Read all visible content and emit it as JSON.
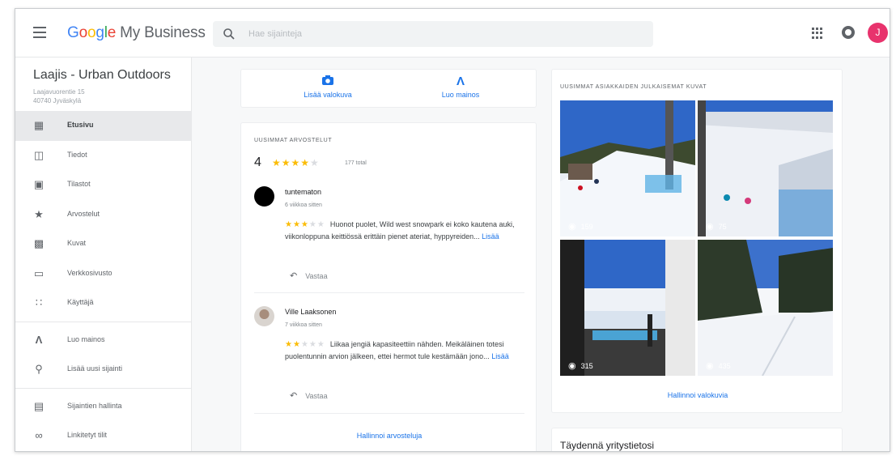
{
  "header": {
    "brand_word": [
      "G",
      "o",
      "o",
      "g",
      "l",
      "e"
    ],
    "product": "My Business",
    "search_placeholder": "Hae sijainteja",
    "avatar_initial": "J",
    "icons": [
      "menu-icon",
      "search-icon",
      "apps-icon",
      "notifications-icon"
    ]
  },
  "sidebar": {
    "business_name": "Laajis - Urban Outdoors",
    "address_line1": "Laajavuorentie 15",
    "address_line2": "40740 Jyväskylä",
    "items": [
      {
        "label": "Etusivu",
        "icon": "home-icon",
        "active": true
      },
      {
        "label": "Tiedot",
        "icon": "store-icon"
      },
      {
        "label": "Tilastot",
        "icon": "insights-icon"
      },
      {
        "label": "Arvostelut",
        "icon": "star-icon"
      },
      {
        "label": "Kuvat",
        "icon": "photos-icon"
      },
      {
        "label": "Verkkosivusto",
        "icon": "website-icon"
      },
      {
        "label": "Käyttäjä",
        "icon": "users-icon"
      },
      {
        "label": "Luo mainos",
        "icon": "ads-icon"
      },
      {
        "label": "Lisää uusi sijainti",
        "icon": "location-pin-icon"
      },
      {
        "label": "Sijaintien hallinta",
        "icon": "locations-icon"
      },
      {
        "label": "Linkitetyt tilit",
        "icon": "link-icon"
      }
    ]
  },
  "actions": {
    "add_photo": "Lisää valokuva",
    "create_ad": "Luo mainos"
  },
  "reviews": {
    "title": "UUSIMMAT ARVOSTELUT",
    "rating": "4",
    "rating_stars": 4,
    "total": "177 total",
    "items": [
      {
        "name": "tuntematon",
        "time": "6 viikkoa sitten",
        "stars": 3,
        "text": "Huonot puolet, Wild west snowpark ei koko kautena auki, viikonloppuna keittiössä erittäin pienet ateriat, hyppyreiden...",
        "more": "Lisää",
        "reply": "Vastaa"
      },
      {
        "name": "Ville Laaksonen",
        "time": "7 viikkoa sitten",
        "stars": 2,
        "text": "Liikaa jengiä kapasiteettiin nähden. Meikäläinen totesi puolentunnin arvion jälkeen, ettei hermot tule kestämään jono...",
        "more": "Lisää",
        "reply": "Vastaa"
      }
    ],
    "manage": "Hallinnoi arvosteluja"
  },
  "photos": {
    "title": "UUSIMMAT ASIAKKAIDEN JULKAISEMAT KUVAT",
    "items": [
      {
        "views": "159"
      },
      {
        "views": "75"
      },
      {
        "views": "315"
      },
      {
        "views": "435"
      }
    ],
    "manage": "Hallinnoi valokuvia"
  },
  "complete": {
    "title": "Täydennä yritystietosi"
  },
  "colors": {
    "accent": "#1a73e8",
    "star": "#fbbc05",
    "avatar": "#e8336d"
  }
}
